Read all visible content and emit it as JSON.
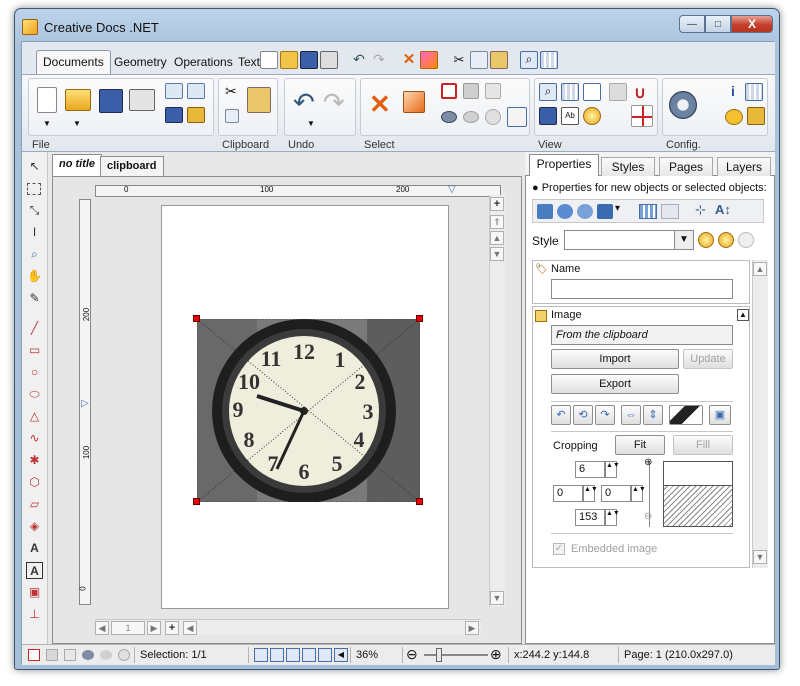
{
  "window": {
    "title": "Creative Docs .NET",
    "controls": {
      "minimize": "—",
      "maximize": "□",
      "close": "X"
    }
  },
  "ribbon": {
    "tabs": [
      "Documents",
      "Geometry",
      "Operations",
      "Text"
    ],
    "active_tab": "Documents",
    "groups": [
      "File",
      "Clipboard",
      "Undo",
      "Select",
      "View",
      "Config."
    ]
  },
  "document_tabs": [
    {
      "label": "no title",
      "active": true
    },
    {
      "label": "clipboard",
      "active": false
    }
  ],
  "rulers": {
    "horizontal_ticks": [
      "0",
      "100",
      "200"
    ],
    "vertical_ticks": [
      "200",
      "100",
      "0"
    ]
  },
  "image": {
    "description_label": "Image"
  },
  "horizontal_scroll": {
    "page": "1"
  },
  "properties_panel": {
    "tabs": [
      "Properties",
      "Styles",
      "Pages",
      "Layers"
    ],
    "active_tab": "Properties",
    "hint": "Properties for new objects or selected objects:",
    "style_label": "Style",
    "style_value": "",
    "name_section": {
      "title": "Name",
      "value": ""
    },
    "image_section": {
      "title": "Image",
      "source": "From the clipboard",
      "import_label": "Import",
      "update_label": "Update",
      "export_label": "Export",
      "cropping_label": "Cropping",
      "fit_label": "Fit",
      "fill_label": "Fill",
      "crop_top": "6",
      "crop_left": "0",
      "crop_right": "0",
      "crop_bottom": "153",
      "embedded_label": "Embedded image"
    }
  },
  "status": {
    "selection": "Selection: 1/1",
    "zoom": "36%",
    "cursor": "x:244.2 y:144.8",
    "page": "Page: 1 (210.0x297.0)"
  },
  "colors": {
    "accent": "#3c7fc4",
    "handle": "#e00000",
    "title_bar": "#b5cde6"
  }
}
